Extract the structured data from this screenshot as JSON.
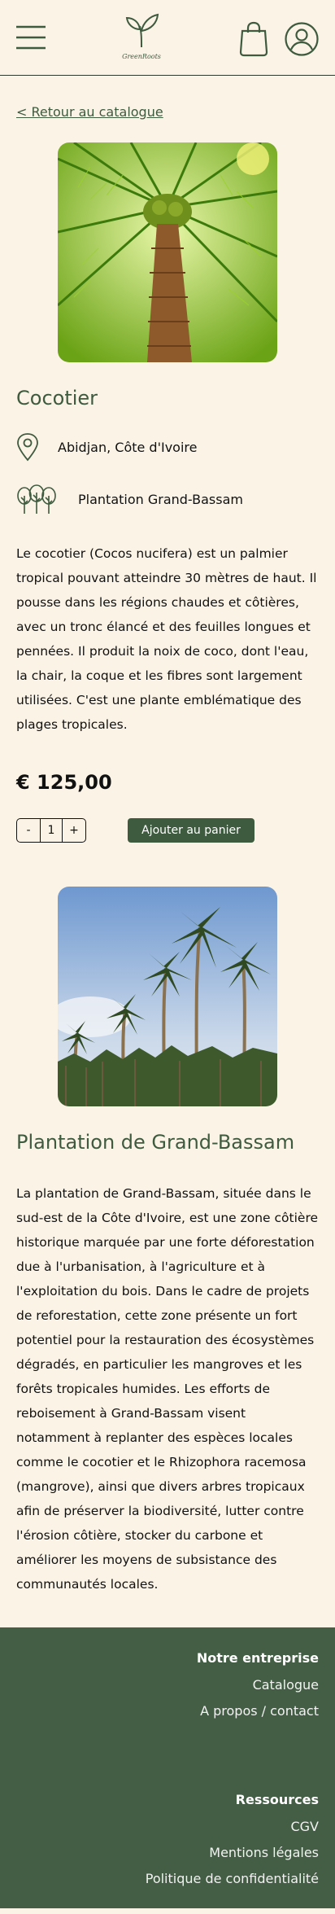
{
  "header": {
    "logo_text": "GreenRoots",
    "icons": [
      "menu-icon",
      "leaf-logo",
      "shopping-bag-icon",
      "user-icon"
    ]
  },
  "back_link": "< Retour au catalogue",
  "product": {
    "name": "Cocotier",
    "location": "Abidjan, Côte d'Ivoire",
    "plantation": "Plantation Grand-Bassam",
    "description": "Le cocotier (Cocos nucifera) est un palmier tropical pouvant atteindre 30 mètres de haut. Il pousse dans les régions chaudes et côtières, avec un tronc élancé et des feuilles longues et pennées. Il produit la noix de coco, dont l'eau, la chair, la coque et les fibres sont largement utilisées. C'est une plante emblématique des plages tropicales.",
    "price": "€ 125,00",
    "quantity": "1",
    "minus": "-",
    "plus": "+",
    "add_to_cart": "Ajouter au panier"
  },
  "plantation": {
    "title": "Plantation de Grand-Bassam",
    "description": "La plantation de Grand-Bassam, située dans le sud-est de la Côte d'Ivoire, est une zone côtière historique marquée par une forte déforestation due à l'urbanisation, à l'agriculture et à l'exploitation du bois. Dans le cadre de projets de reforestation, cette zone présente un fort potentiel pour la restauration des écosystèmes dégradés, en particulier les mangroves et les forêts tropicales humides. Les efforts de reboisement à Grand-Bassam visent notamment à replanter des espèces locales comme le cocotier et le Rhizophora racemosa (mangrove), ainsi que divers arbres tropicaux afin de préserver la biodiversité, lutter contre l'érosion côtière, stocker du carbone et améliorer les moyens de subsistance des communautés locales."
  },
  "footer": {
    "company_heading": "Notre entreprise",
    "company_links": [
      "Catalogue",
      "A propos / contact"
    ],
    "resources_heading": "Ressources",
    "resources_links": [
      "CGV",
      "Mentions légales",
      "Politique de confidentialité"
    ]
  },
  "colors": {
    "background": "#FBF3E6",
    "brand_green": "#3E5A3F",
    "footer_green": "#445E45"
  }
}
